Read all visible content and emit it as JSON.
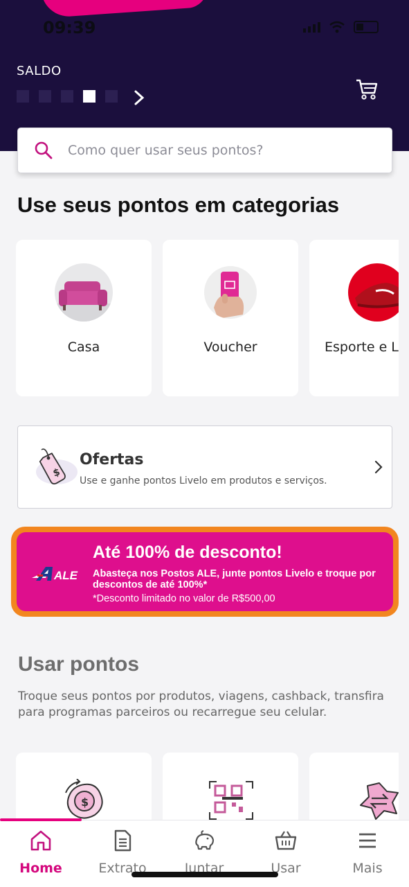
{
  "status_bar": {
    "time": "09:39"
  },
  "header": {
    "saldo_label": "SALDO"
  },
  "search": {
    "placeholder": "Como quer usar seus pontos?"
  },
  "categories": {
    "title": "Use seus pontos em categorias",
    "items": [
      {
        "label": "Casa",
        "icon": "sofa-image"
      },
      {
        "label": "Voucher",
        "icon": "phone-voucher-image"
      },
      {
        "label": "Esporte e L",
        "icon": "sneaker-image"
      }
    ]
  },
  "ofertas": {
    "title": "Ofertas",
    "subtitle": "Use e ganhe pontos Livelo em produtos e serviços."
  },
  "promo_banner": {
    "brand": "ALE",
    "title": "Até 100% de desconto!",
    "body": "Abasteça nos Postos ALE, junte pontos Livelo e troque por descontos de até 100%*",
    "note": "*Desconto limitado no valor de R$500,00",
    "colors": {
      "background": "#de0f8d",
      "border": "#f2861f"
    }
  },
  "usar_pontos": {
    "title": "Usar pontos",
    "description": "Troque seus pontos por produtos, viagens, cashback, transfira para programas parceiros ou recarregue seu celular.",
    "items": [
      {
        "icon": "cashback-icon"
      },
      {
        "icon": "qr-code-icon"
      },
      {
        "icon": "transfer-icon"
      }
    ]
  },
  "bottom_nav": {
    "items": [
      {
        "label": "Home",
        "icon": "home-icon",
        "active": true
      },
      {
        "label": "Extrato",
        "icon": "document-icon",
        "active": false
      },
      {
        "label": "Juntar",
        "icon": "piggy-bank-icon",
        "active": false
      },
      {
        "label": "Usar",
        "icon": "basket-icon",
        "active": false
      },
      {
        "label": "Mais",
        "icon": "menu-icon",
        "active": false
      }
    ]
  },
  "colors": {
    "brand_pink": "#e6007e",
    "header_bg": "#1b0f3d"
  }
}
